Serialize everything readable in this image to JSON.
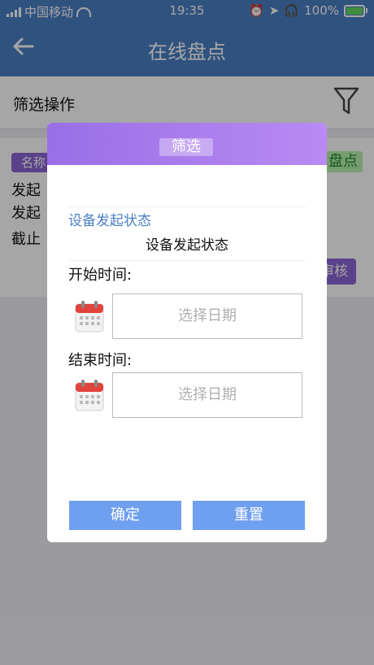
{
  "status_bar": {
    "carrier": "中国移动",
    "time": "19:35",
    "battery": "100%"
  },
  "nav": {
    "title": "在线盘点"
  },
  "filter_bar": {
    "label": "筛选操作"
  },
  "card": {
    "name_badge": "名称",
    "status_badge": "盘点",
    "line1": "发起",
    "line2": "发起",
    "line3": "截止",
    "audit_button": "审核"
  },
  "modal": {
    "title": "筛选",
    "status_label": "设备发起状态",
    "status_value": "设备发起状态",
    "start_label": "开始时间:",
    "start_placeholder": "选择日期",
    "end_label": "结束时间:",
    "end_placeholder": "选择日期",
    "confirm": "确定",
    "reset": "重置"
  },
  "colors": {
    "nav_bg": "#4a7fc4",
    "modal_header": "#9a6fe6",
    "button_blue": "#6fa0f0",
    "badge_purple": "#8a66d6",
    "badge_green": "#b8f0b0"
  }
}
